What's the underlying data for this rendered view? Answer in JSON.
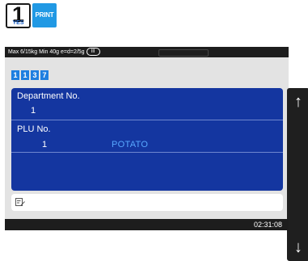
{
  "keys": {
    "key1_digit": "1",
    "key1_label": "YES",
    "print_label": "PRINT"
  },
  "status": {
    "spec": "Max 6/15kg Min 40g e=d=2/5g",
    "accuracy_class": "III"
  },
  "digits": [
    "1",
    "1",
    "3",
    "7"
  ],
  "department": {
    "label": "Department No.",
    "value": "1"
  },
  "plu": {
    "label": "PLU No.",
    "number": "1",
    "name": "POTATO"
  },
  "input": {
    "value": "",
    "icon": "edit-note-icon"
  },
  "nav": {
    "up_icon": "arrow-up-icon",
    "down_icon": "arrow-down-icon"
  },
  "clock": "02:31:08",
  "colors": {
    "main_panel": "#1436a0",
    "digit_box": "#1f7fe0",
    "print_key": "#2199e4",
    "plu_name": "#58a8ff",
    "bars": "#1d1d1d"
  }
}
